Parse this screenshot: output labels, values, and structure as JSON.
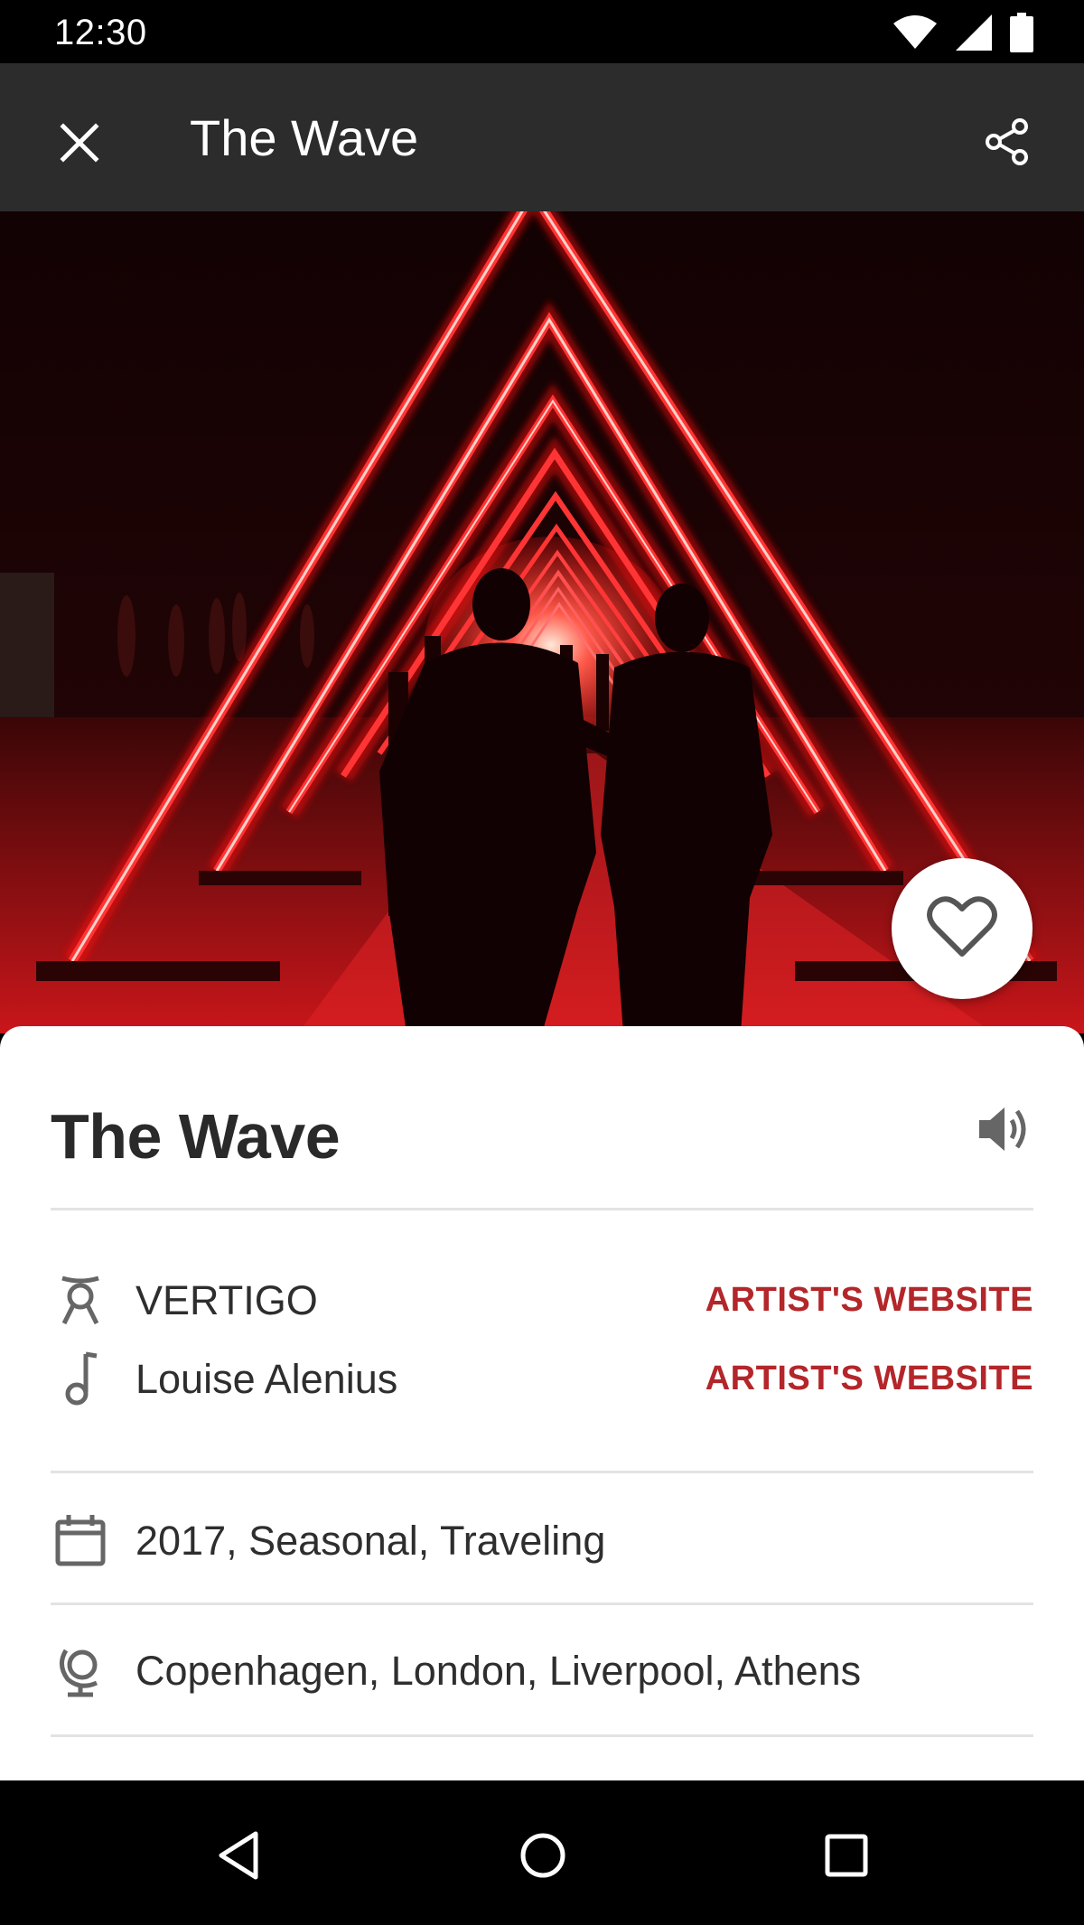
{
  "status_bar": {
    "time": "12:30",
    "icons": [
      "wifi-icon",
      "signal-icon",
      "battery-icon"
    ]
  },
  "app_bar": {
    "title": "The Wave",
    "close_icon": "close-icon",
    "share_icon": "share-icon"
  },
  "hero": {
    "image_description_icon": "photo",
    "favorite_icon": "heart-outline-icon"
  },
  "detail": {
    "title": "The Wave",
    "audio_icon": "speaker-icon",
    "credits": [
      {
        "icon": "dancer-icon",
        "name": "VERTIGO",
        "link": "ARTIST'S WEBSITE"
      },
      {
        "icon": "music-note-icon",
        "name": "Louise Alenius",
        "link": "ARTIST'S WEBSITE"
      }
    ],
    "dates": {
      "icon": "calendar-icon",
      "text": "2017, Seasonal, Traveling"
    },
    "locations": {
      "icon": "globe-icon",
      "text": "Copenhagen, London, Liverpool, Athens"
    }
  },
  "nav_bar": {
    "back_icon": "back-triangle-icon",
    "home_icon": "home-circle-icon",
    "recents_icon": "recents-square-icon"
  },
  "colors": {
    "app_bar": "#2c2c2c",
    "accent_link": "#b3262a",
    "text_dark": "#2a2a2a",
    "neon_red": "#ff2a2a"
  }
}
